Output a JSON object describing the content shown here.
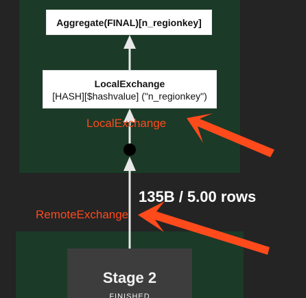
{
  "nodes": {
    "aggregate": {
      "label": "Aggregate(FINAL)[n_regionkey]"
    },
    "local_exchange": {
      "title": "LocalExchange",
      "detail": "[HASH][$hashvalue] (\"n_regionkey\")"
    }
  },
  "annotations": {
    "local": "LocalExchange",
    "remote": "RemoteExchange"
  },
  "edge": {
    "label": "135B / 5.00 rows"
  },
  "stage": {
    "title": "Stage 2",
    "status": "FINISHED"
  },
  "colors": {
    "background": "#242424",
    "stage_panel": "#1b3a27",
    "annotation": "#ff4a1c",
    "edge": "#e8e8e8",
    "stage_box": "#3d3d3d"
  }
}
